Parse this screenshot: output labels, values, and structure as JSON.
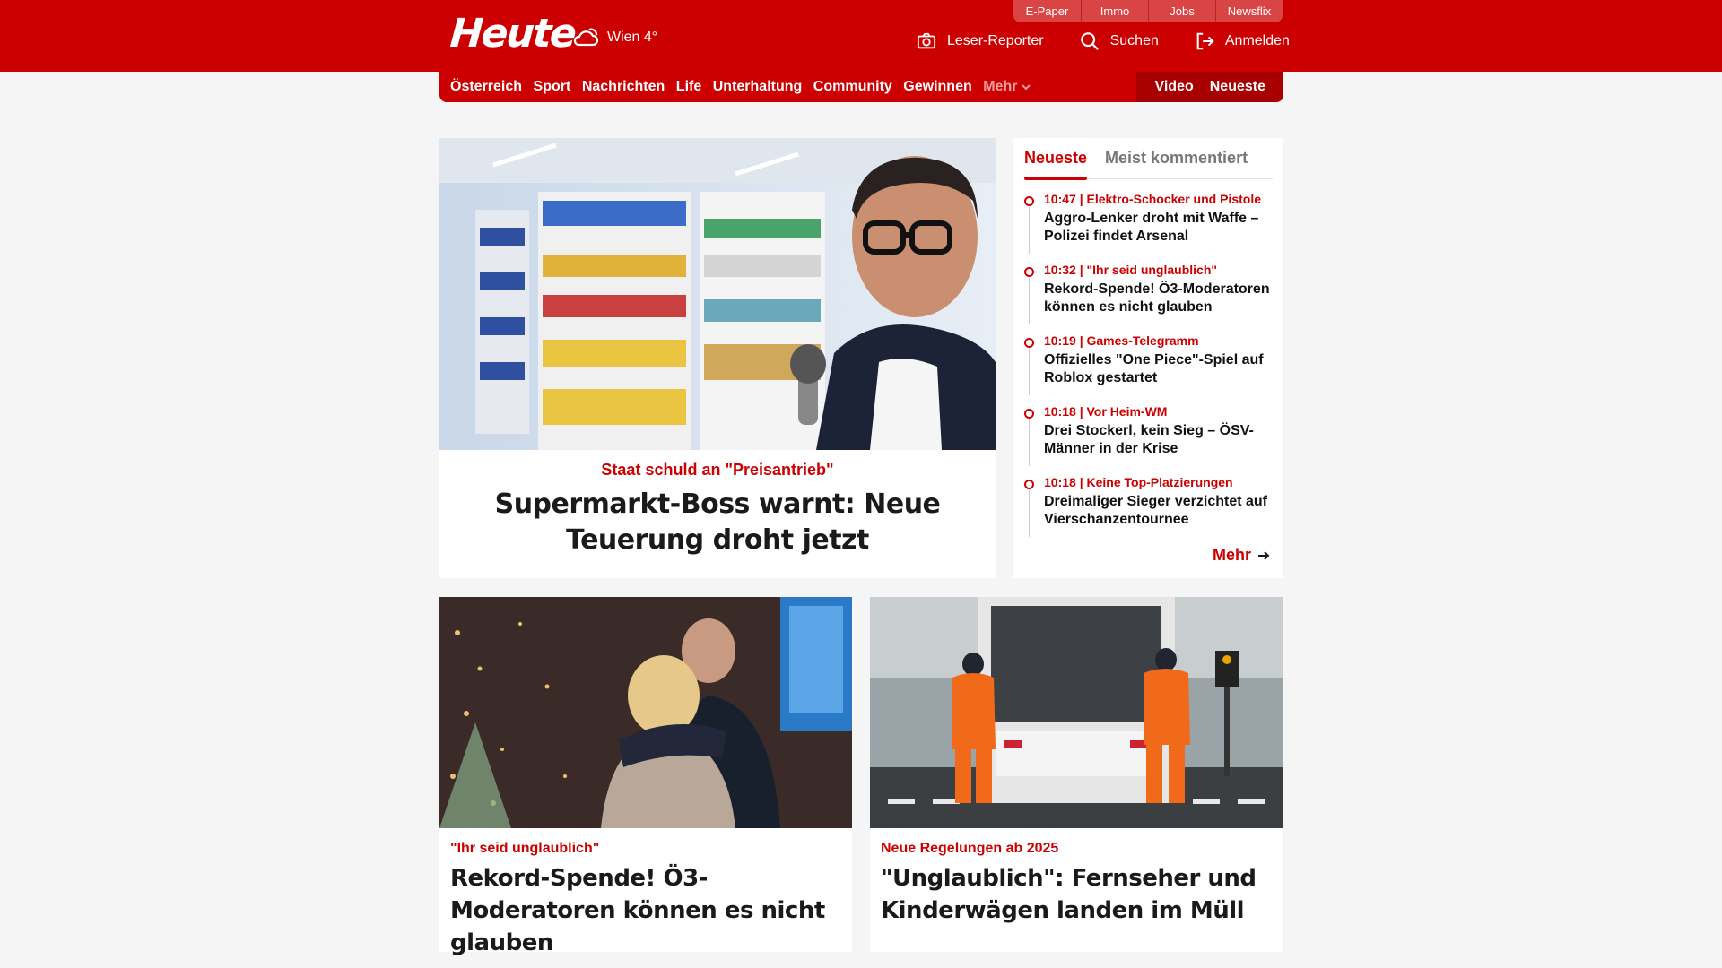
{
  "header": {
    "logo": "Heute",
    "weather": "Wien 4°",
    "utility": [
      "E-Paper",
      "Immo",
      "Jobs",
      "Newsflix"
    ],
    "actions": {
      "reporter": "Leser-Reporter",
      "search": "Suchen",
      "login": "Anmelden"
    }
  },
  "nav": {
    "items": [
      "Österreich",
      "Sport",
      "Nachrichten",
      "Life",
      "Unterhaltung",
      "Community",
      "Gewinnen"
    ],
    "more": "Mehr",
    "right": [
      "Video",
      "Neueste"
    ]
  },
  "hero": {
    "kicker": "Staat schuld an \"Preisantrieb\"",
    "title": "Supermarkt-Boss warnt: Neue Teuerung droht jetzt"
  },
  "sidebar": {
    "tabs": [
      "Neueste",
      "Meist kommentiert"
    ],
    "items": [
      {
        "meta": "10:47 | Elektro-Schocker und Pistole",
        "title": "Aggro-Lenker droht mit Waffe – Polizei findet Arsenal"
      },
      {
        "meta": "10:32 | \"Ihr seid unglaublich\"",
        "title": "Rekord-Spende! Ö3-Moderatoren können es nicht glauben"
      },
      {
        "meta": "10:19 | Games-Telegramm",
        "title": "Offizielles \"One Piece\"-Spiel auf Roblox gestartet"
      },
      {
        "meta": "10:18 | Vor Heim-WM",
        "title": "Drei Stockerl, kein Sieg – ÖSV-Männer in der Krise"
      },
      {
        "meta": "10:18 | Keine Top-Platzierungen",
        "title": "Dreimaliger Sieger verzichtet auf Vierschanzentournee"
      }
    ],
    "more": "Mehr"
  },
  "cards": [
    {
      "kicker": "\"Ihr seid unglaublich\"",
      "title": "Rekord-Spende! Ö3-Moderatoren können es nicht glauben"
    },
    {
      "kicker": "Neue Regelungen ab 2025",
      "title": "\"Unglaublich\": Fernseher und Kinderwägen landen im Müll"
    }
  ],
  "colors": {
    "brand": "#cc0000",
    "brand_dark": "#a80000",
    "background": "#f5f5f5"
  }
}
